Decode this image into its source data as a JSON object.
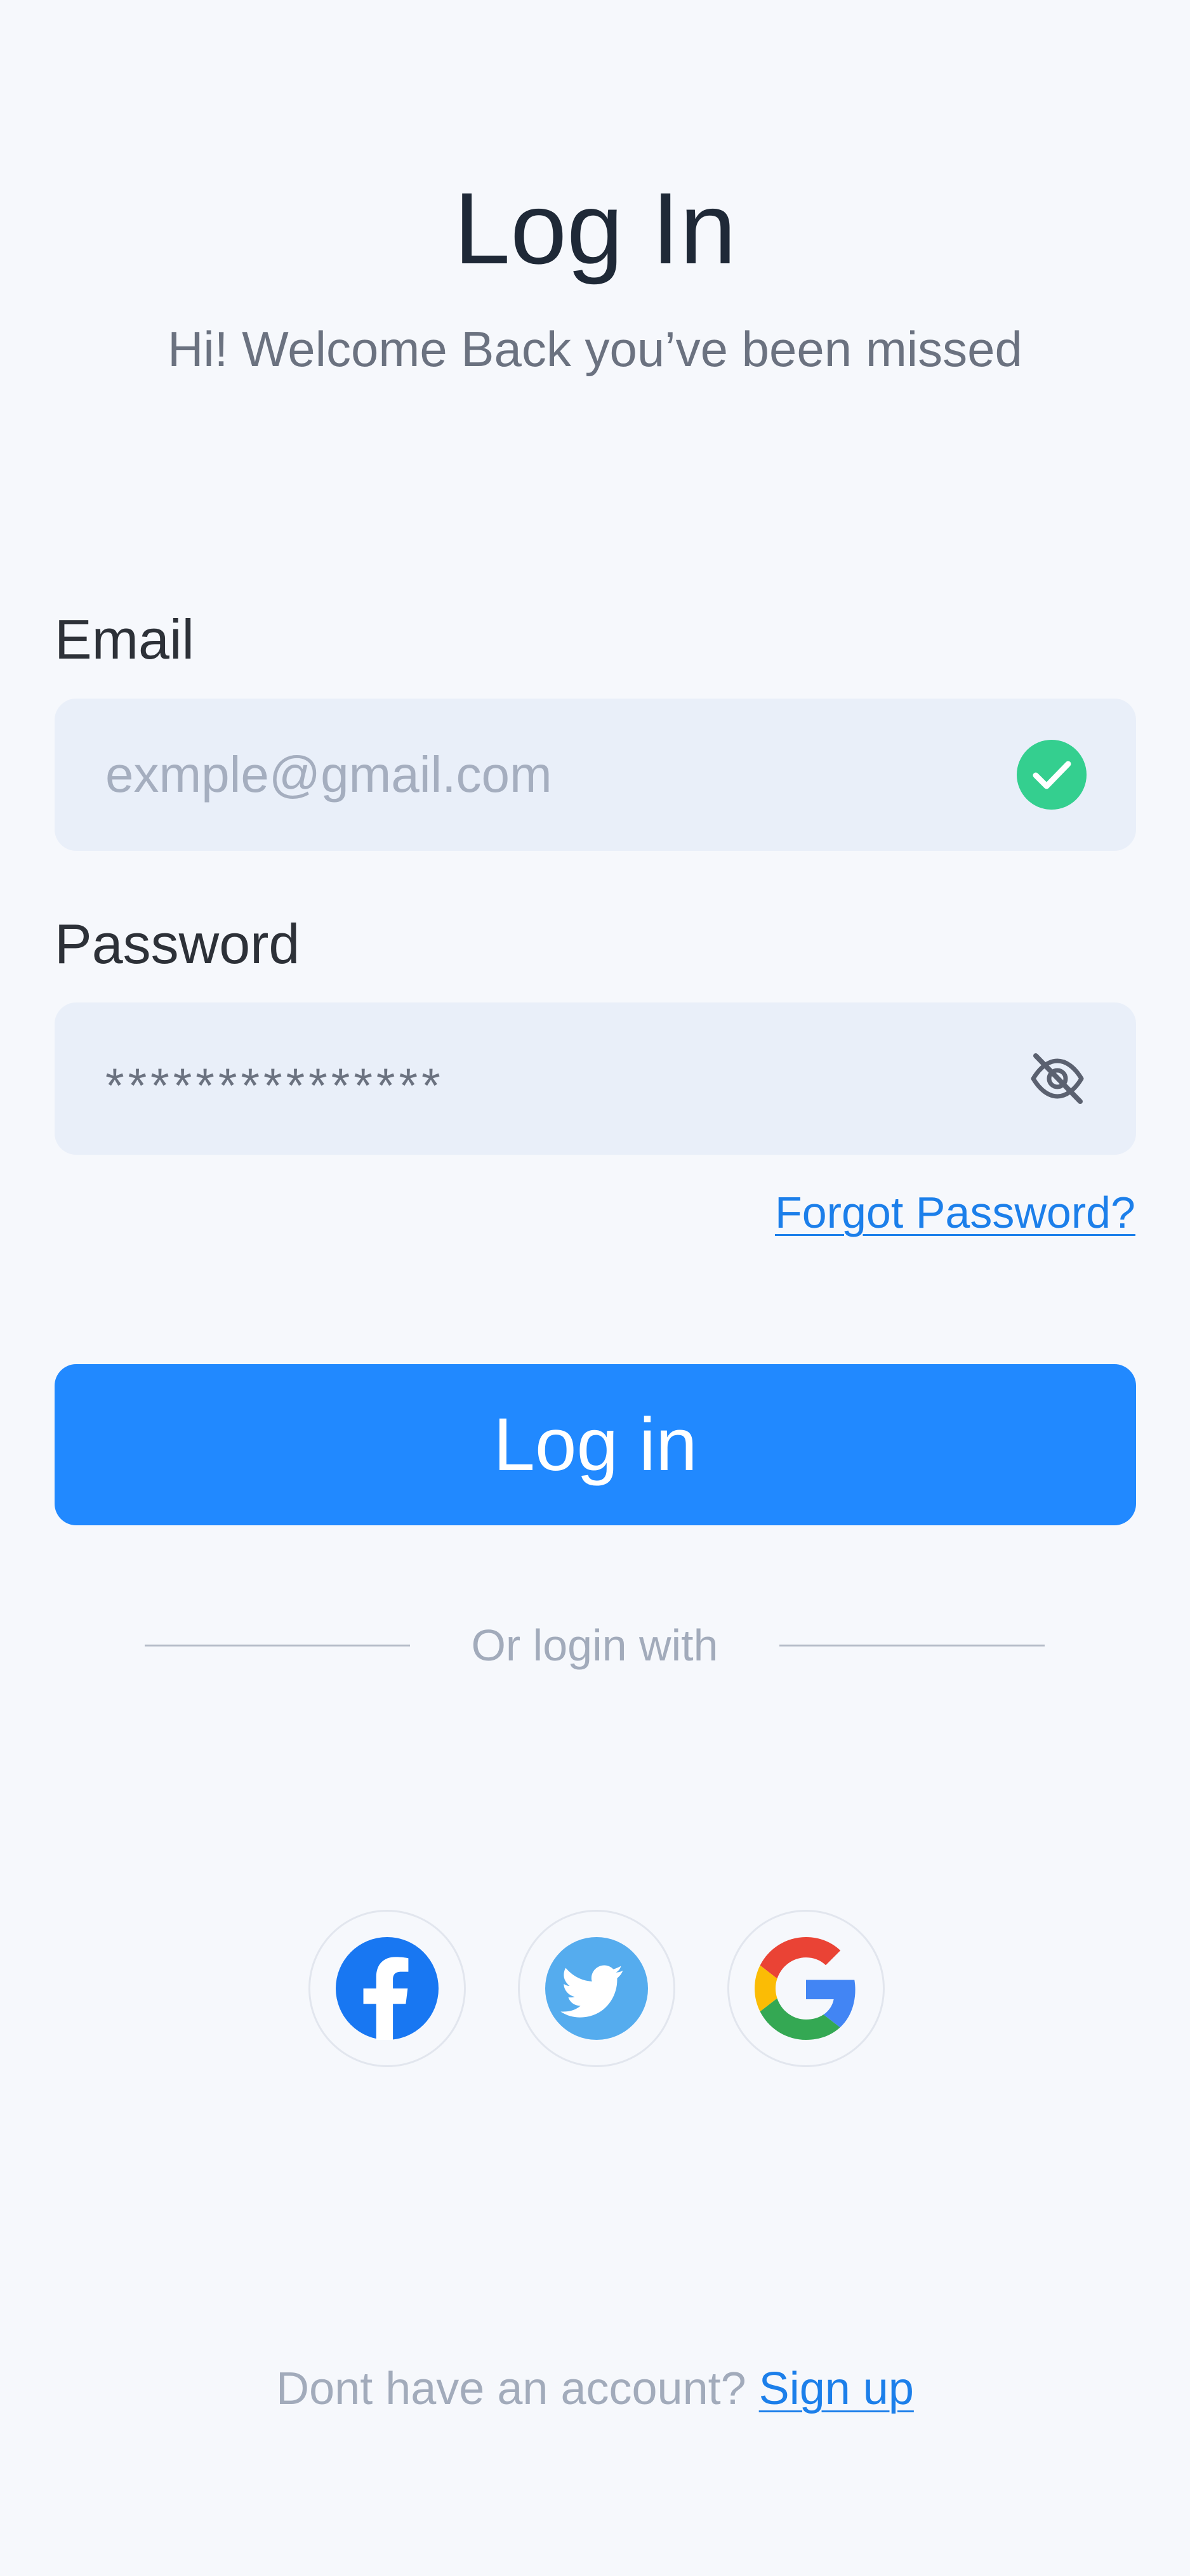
{
  "header": {
    "title": "Log In",
    "subtitle": "Hi! Welcome Back you’ve been missed"
  },
  "form": {
    "email_label": "Email",
    "email_placeholder": "exmple@gmail.com",
    "email_valid_icon": "check-circle-icon",
    "password_label": "Password",
    "password_value": "***************",
    "password_visibility_icon": "eye-off-icon",
    "forgot_password": "Forgot Password?",
    "submit_label": "Log in"
  },
  "social": {
    "divider_text": "Or login with",
    "providers": [
      {
        "name": "Facebook",
        "icon": "facebook-icon"
      },
      {
        "name": "Twitter",
        "icon": "twitter-icon"
      },
      {
        "name": "Google",
        "icon": "google-icon"
      }
    ]
  },
  "footer": {
    "prompt": "Dont have an account?",
    "signup_link": "Sign up"
  },
  "colors": {
    "background": "#f6f8fc",
    "primary": "#2189ff",
    "link": "#1c7fea",
    "input_bg": "#e9eff9",
    "success": "#34cf8f",
    "facebook": "#1877f2",
    "twitter": "#55acee"
  }
}
